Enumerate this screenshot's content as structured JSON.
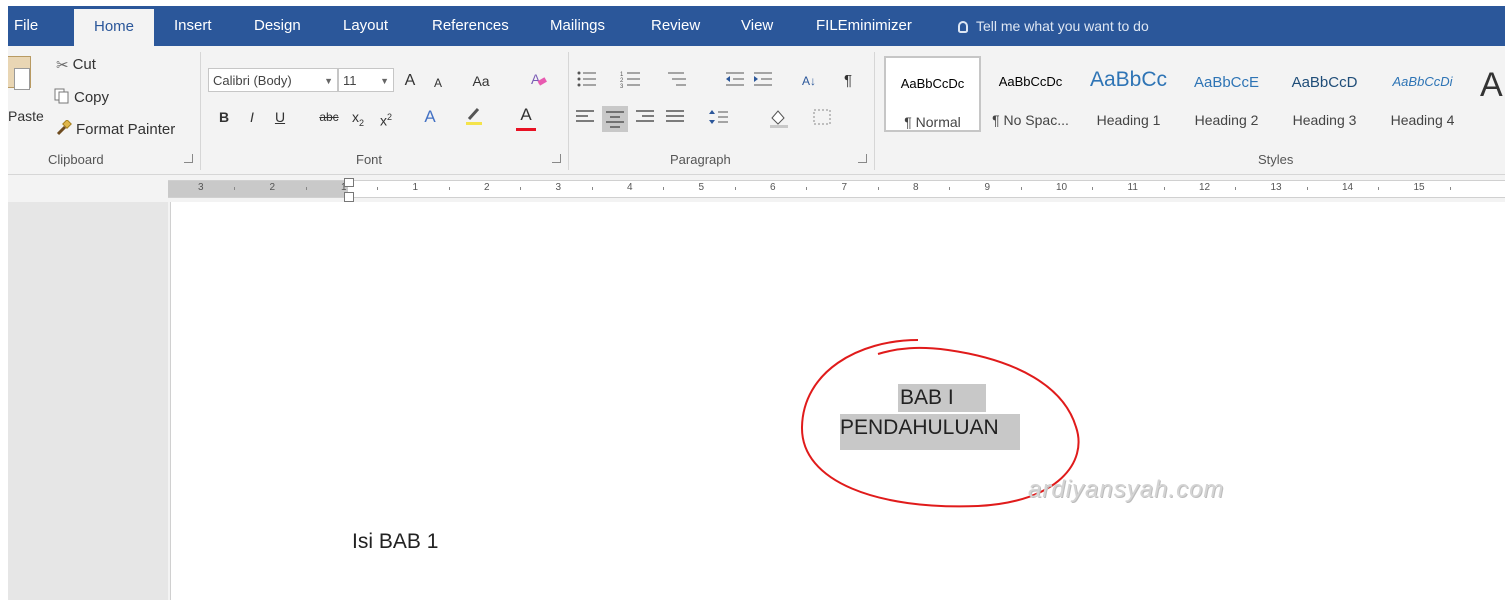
{
  "tabs": [
    "File",
    "Home",
    "Insert",
    "Design",
    "Layout",
    "References",
    "Mailings",
    "Review",
    "View",
    "FILEminimizer"
  ],
  "active_tab": "Home",
  "tell_me": "Tell me what you want to do",
  "clipboard": {
    "paste_label": "Paste",
    "cut": "Cut",
    "copy": "Copy",
    "format_painter": "Format Painter",
    "group_label": "Clipboard"
  },
  "font": {
    "font_name": "Calibri (Body)",
    "font_size": "11",
    "grow": "A",
    "shrink": "A",
    "change_case": "Aa",
    "bold": "B",
    "italic": "I",
    "underline": "U",
    "strike": "abc",
    "subscript": "x",
    "superscript": "x",
    "text_effects": "A",
    "font_color": "A",
    "group_label": "Font"
  },
  "paragraph": {
    "sort": "A↓",
    "pilcrow": "¶",
    "group_label": "Paragraph"
  },
  "styles": {
    "items": [
      {
        "preview": "AaBbCcDc",
        "name": "¶ Normal",
        "color": "#111111"
      },
      {
        "preview": "AaBbCcDc",
        "name": "¶ No Spac...",
        "color": "#111111"
      },
      {
        "preview": "AaBbCc",
        "name": "Heading 1",
        "color": "#2e74b5"
      },
      {
        "preview": "AaBbCcE",
        "name": "Heading 2",
        "color": "#2e74b5"
      },
      {
        "preview": "AaBbCcD",
        "name": "Heading 3",
        "color": "#1f4d78"
      },
      {
        "preview": "AaBbCcDi",
        "name": "Heading 4",
        "color": "#2e74b5"
      }
    ],
    "more_glyph": "A",
    "group_label": "Styles"
  },
  "ruler_numbers": [
    "3",
    "2",
    "1",
    "1",
    "2",
    "3",
    "4",
    "5",
    "6",
    "7",
    "8",
    "9",
    "10",
    "11",
    "12",
    "13",
    "14",
    "15"
  ],
  "document": {
    "heading_line1": "BAB I",
    "heading_line2": "PENDAHULUAN",
    "body": "Isi BAB 1",
    "watermark": "ardiyansyah.com"
  },
  "colors": {
    "ribbon_blue": "#2b579a",
    "annotation_red": "#e01b1b",
    "highlight_yellow": "#f4e34a",
    "font_red": "#e81123"
  }
}
